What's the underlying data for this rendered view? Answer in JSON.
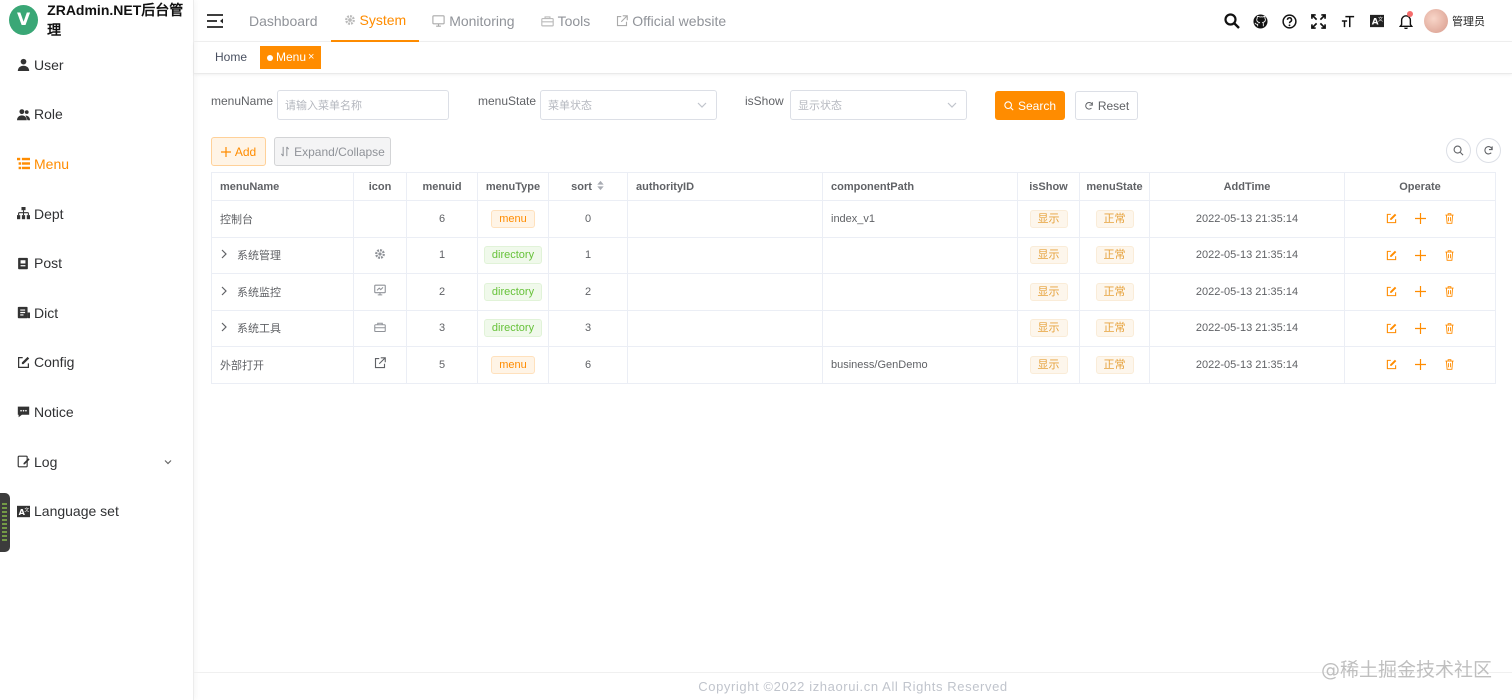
{
  "app": {
    "logo_letter": "V",
    "title": "ZRAdmin.NET后台管理"
  },
  "sidebar": {
    "items": [
      {
        "label": "User",
        "icon": "user-icon"
      },
      {
        "label": "Role",
        "icon": "role-icon"
      },
      {
        "label": "Menu",
        "icon": "tree-table-icon",
        "active": true
      },
      {
        "label": "Dept",
        "icon": "tree-icon"
      },
      {
        "label": "Post",
        "icon": "post-icon"
      },
      {
        "label": "Dict",
        "icon": "dict-icon"
      },
      {
        "label": "Config",
        "icon": "edit-icon"
      },
      {
        "label": "Notice",
        "icon": "message-icon"
      },
      {
        "label": "Log",
        "icon": "log-icon",
        "has_children": true
      },
      {
        "label": "Language set",
        "icon": "language-icon"
      }
    ]
  },
  "topnav": {
    "tabs": [
      {
        "label": "Dashboard"
      },
      {
        "label": "System",
        "active": true,
        "icon": "gear-icon"
      },
      {
        "label": "Monitoring",
        "icon": "monitor-icon"
      },
      {
        "label": "Tools",
        "icon": "toolbox-icon"
      },
      {
        "label": "Official website",
        "icon": "external-link-icon"
      }
    ],
    "user_name": "管理员"
  },
  "tags": {
    "home": "Home",
    "active": "Menu"
  },
  "filter": {
    "menuName_label": "menuName",
    "menuName_placeholder": "请输入菜单名称",
    "menuState_label": "menuState",
    "menuState_placeholder": "菜单状态",
    "isShow_label": "isShow",
    "isShow_placeholder": "显示状态",
    "search_label": "Search",
    "reset_label": "Reset"
  },
  "toolbar": {
    "add_label": "Add",
    "expand_label": "Expand/Collapse"
  },
  "table": {
    "headers": [
      "menuName",
      "icon",
      "menuid",
      "menuType",
      "sort",
      "authorityID",
      "componentPath",
      "isShow",
      "menuState",
      "AddTime",
      "Operate"
    ],
    "rows": [
      {
        "menuName": "控制台",
        "expandable": false,
        "icon": "",
        "menuid": "6",
        "menuType": "menu",
        "sort": "0",
        "authorityID": "",
        "componentPath": "index_v1",
        "isShow": "显示",
        "menuState": "正常",
        "addTime": "2022-05-13 21:35:14"
      },
      {
        "menuName": "系统管理",
        "expandable": true,
        "icon": "gear-icon",
        "menuid": "1",
        "menuType": "directory",
        "sort": "1",
        "authorityID": "",
        "componentPath": "",
        "isShow": "显示",
        "menuState": "正常",
        "addTime": "2022-05-13 21:35:14"
      },
      {
        "menuName": "系统监控",
        "expandable": true,
        "icon": "monitor-icon",
        "menuid": "2",
        "menuType": "directory",
        "sort": "2",
        "authorityID": "",
        "componentPath": "",
        "isShow": "显示",
        "menuState": "正常",
        "addTime": "2022-05-13 21:35:14"
      },
      {
        "menuName": "系统工具",
        "expandable": true,
        "icon": "toolbox-icon",
        "menuid": "3",
        "menuType": "directory",
        "sort": "3",
        "authorityID": "",
        "componentPath": "",
        "isShow": "显示",
        "menuState": "正常",
        "addTime": "2022-05-13 21:35:14"
      },
      {
        "menuName": "外部打开",
        "expandable": false,
        "icon": "external-link-icon",
        "menuid": "5",
        "menuType": "menu",
        "sort": "6",
        "authorityID": "",
        "componentPath": "business/GenDemo",
        "isShow": "显示",
        "menuState": "正常",
        "addTime": "2022-05-13 21:35:14"
      }
    ]
  },
  "footer": {
    "copyright": "Copyright ©2022 izhaorui.cn All Rights Reserved"
  },
  "watermark": "@稀土掘金技术社区",
  "colors": {
    "accent": "#ff8c00",
    "success": "#67c23a",
    "warning": "#e6a23c",
    "logo": "#3aa776"
  }
}
